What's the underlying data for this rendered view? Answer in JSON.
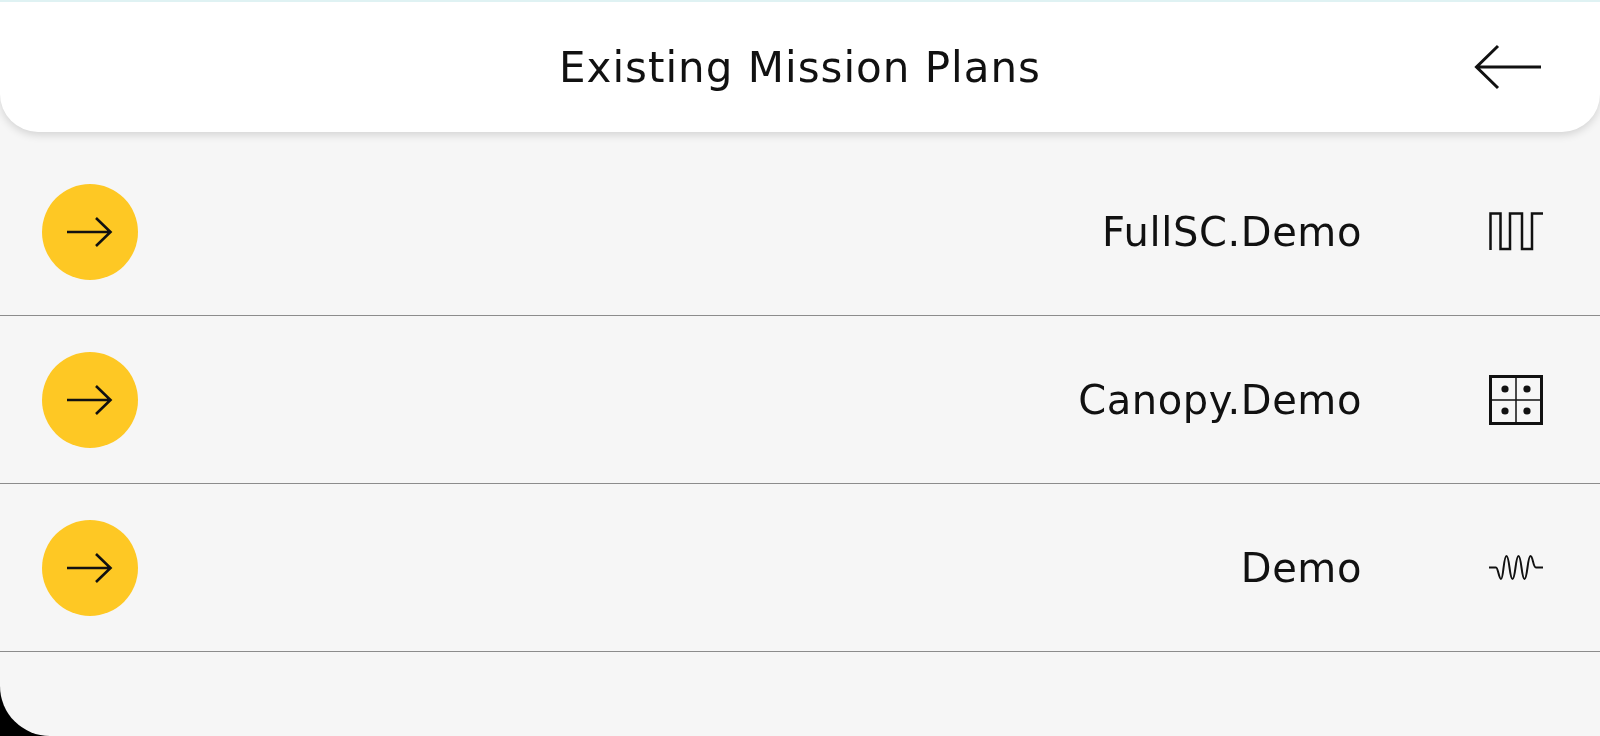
{
  "header": {
    "title": "Existing Mission Plans"
  },
  "plans": [
    {
      "name": "FullSC.Demo",
      "kind": "pulse"
    },
    {
      "name": "Canopy.Demo",
      "kind": "grid"
    },
    {
      "name": "Demo",
      "kind": "wave"
    }
  ]
}
